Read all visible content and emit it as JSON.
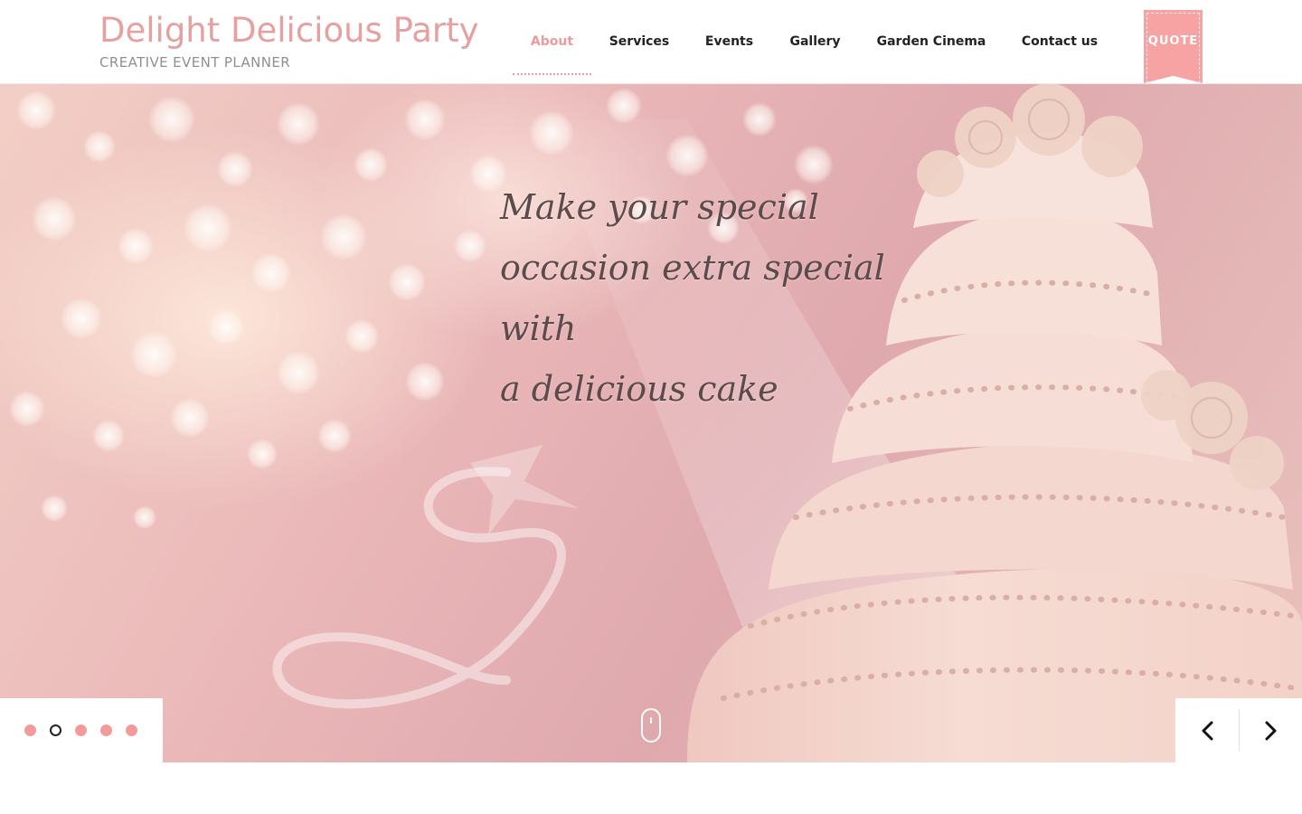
{
  "brand": {
    "title": "Delight Delicious Party",
    "tagline": "CREATIVE EVENT PLANNER"
  },
  "nav": {
    "items": [
      {
        "label": "About",
        "active": true
      },
      {
        "label": "Services",
        "active": false
      },
      {
        "label": "Events",
        "active": false
      },
      {
        "label": "Gallery",
        "active": false
      },
      {
        "label": "Garden Cinema",
        "active": false
      },
      {
        "label": "Contact us",
        "active": false
      }
    ],
    "quote_label": "QUOTE"
  },
  "hero": {
    "headline_lines": [
      "Make your special",
      "occasion extra special with",
      "a delicious cake"
    ],
    "slide_count": 5,
    "active_slide": 2
  },
  "colors": {
    "accent": "#f7a3a3",
    "brand_text": "#e5a0a0",
    "active_nav": "#ee9a9a",
    "nav_text": "#222222"
  },
  "icons": {
    "prev": "chevron-left-icon",
    "next": "chevron-right-icon",
    "scroll": "mouse-scroll-icon"
  }
}
